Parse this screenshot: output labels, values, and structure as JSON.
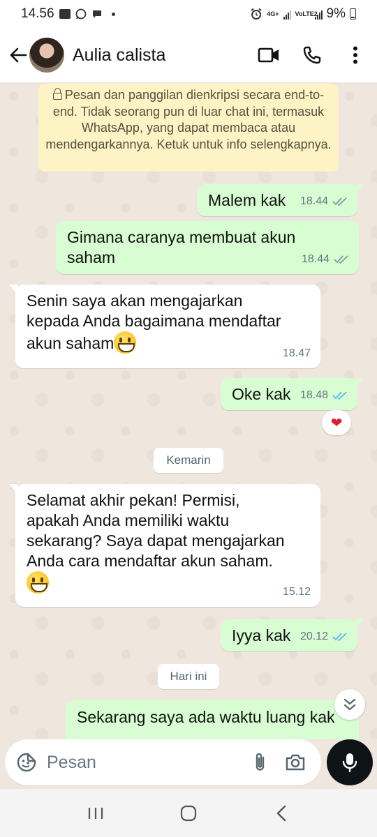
{
  "status_bar": {
    "time": "14.56",
    "network": "4G+",
    "volte": "VoLTE2",
    "battery": "9%"
  },
  "header": {
    "contact_name": "Aulia calista"
  },
  "encryption_notice": "Pesan dan panggilan dienkripsi secara end-to-end. Tidak seorang pun di luar chat ini, termasuk WhatsApp, yang dapat membaca atau mendengarkannya. Ketuk untuk info selengkapnya.",
  "messages": [
    {
      "direction": "outgoing",
      "lines": [
        "Malem kak"
      ],
      "time": "18.44",
      "status": "delivered"
    },
    {
      "direction": "outgoing",
      "lines": [
        "Gimana caranya membuat akun",
        "saham"
      ],
      "time": "18.44",
      "status": "delivered"
    },
    {
      "direction": "incoming",
      "lines": [
        "Senin saya akan mengajarkan",
        "kepada Anda bagaimana mendaftar",
        "akun saham"
      ],
      "emoji": "grinning-face",
      "time": "18.47"
    },
    {
      "direction": "outgoing",
      "lines": [
        "Oke kak"
      ],
      "time": "18.48",
      "status": "read",
      "reaction": "❤"
    },
    {
      "direction": "incoming",
      "lines": [
        "Selamat akhir pekan! Permisi,",
        "apakah Anda memiliki waktu",
        "sekarang? Saya dapat mengajarkan",
        "Anda cara mendaftar akun saham."
      ],
      "emoji": "grinning-face",
      "time": "15.12"
    },
    {
      "direction": "outgoing",
      "lines": [
        "Iyya kak"
      ],
      "time": "20.12",
      "status": "read"
    },
    {
      "direction": "outgoing",
      "lines": [
        "Sekarang saya ada waktu luang kak"
      ]
    }
  ],
  "date_chips": [
    "Kemarin",
    "Hari ini"
  ],
  "composer": {
    "placeholder": "Pesan"
  },
  "colors": {
    "outgoing_bubble": "#d8fdd2",
    "incoming_bubble": "#ffffff",
    "encryption_bg": "#fdf3c4",
    "read_tick": "#53bdeb",
    "chat_bg": "#efe7de",
    "mic_button": "#0e1416"
  }
}
